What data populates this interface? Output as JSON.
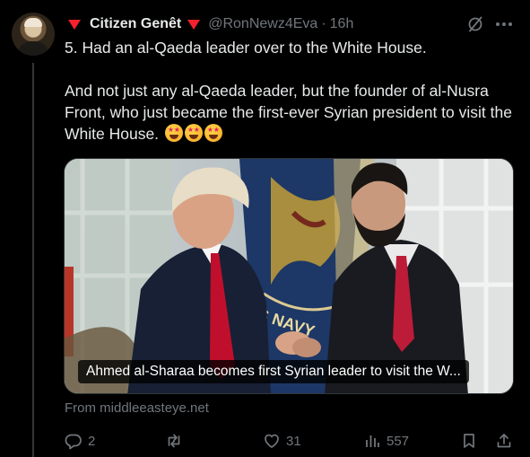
{
  "post": {
    "author_name": "Citizen Genêt",
    "handle": "@RonNewz4Eva",
    "separator": "·",
    "time": "16h",
    "text_paragraph_1": "5. Had an al-Qaeda leader over to the White House.",
    "text_paragraph_2": "And not just any al-Qaeda leader, but the founder of al-Nusra Front, who just became the first-ever Syrian president to visit the White House.",
    "emoji_names": [
      "star-struck-emoji",
      "star-struck-emoji",
      "star-struck-emoji"
    ]
  },
  "media": {
    "caption": "Ahmed al-Sharaa becomes first Syrian leader to visit the W...",
    "flag_text": "S NAVY",
    "source": "From middleeasteye.net"
  },
  "actions": {
    "replies": "2",
    "reposts": "",
    "likes": "31",
    "views": "557"
  },
  "colors": {
    "background": "#000000",
    "text_primary": "#e7e9ea",
    "text_secondary": "#71767b",
    "flag_triangle": "#f4212e",
    "border": "#333639"
  }
}
